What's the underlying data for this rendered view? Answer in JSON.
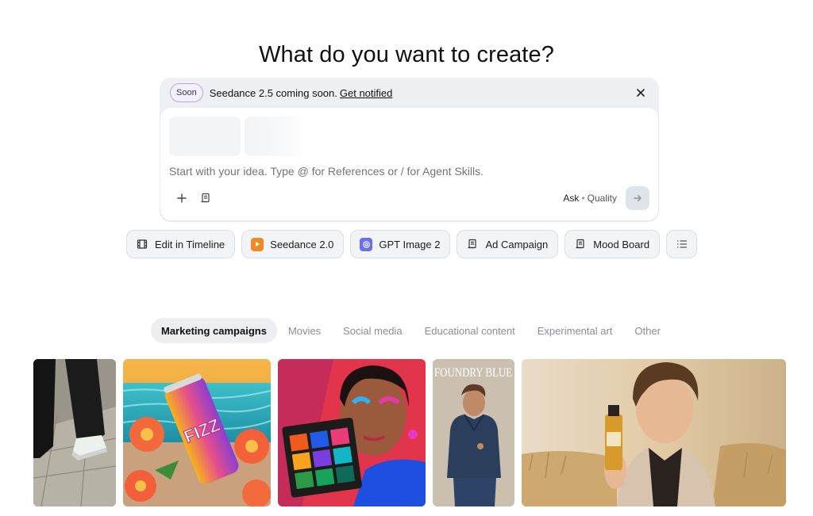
{
  "page": {
    "title": "What do you want to create?"
  },
  "banner": {
    "badge": "Soon",
    "text": "Seedance 2.5 coming soon.",
    "link": "Get notified",
    "close_icon": "close-icon"
  },
  "composer": {
    "placeholder": "Start with your idea. Type @ for References or / for Agent Skills.",
    "model": "Ask",
    "separator": "•",
    "quality": "Quality",
    "add_icon": "plus-icon",
    "skills_icon": "scroll-icon",
    "send_icon": "arrow-right-icon"
  },
  "chips": [
    {
      "label": "Edit in Timeline",
      "icon": "film-icon"
    },
    {
      "label": "Seedance 2.0",
      "icon": "seedance-icon"
    },
    {
      "label": "GPT Image 2",
      "icon": "gpt-icon"
    },
    {
      "label": "Ad Campaign",
      "icon": "scroll-icon"
    },
    {
      "label": "Mood Board",
      "icon": "scroll-icon"
    },
    {
      "label": "",
      "icon": "list-icon"
    }
  ],
  "tabs": [
    {
      "label": "Marketing campaigns",
      "active": true
    },
    {
      "label": "Movies",
      "active": false
    },
    {
      "label": "Social media",
      "active": false
    },
    {
      "label": "Educational content",
      "active": false
    },
    {
      "label": "Experimental art",
      "active": false
    },
    {
      "label": "Other",
      "active": false
    }
  ],
  "gallery": [
    {
      "subject": "sneaker-walking-photo"
    },
    {
      "subject": "fizz-can-poolside-photo",
      "text": "FIZZ"
    },
    {
      "subject": "makeup-palette-portrait-photo"
    },
    {
      "subject": "denim-magazine-cover-photo",
      "text": "FOUNDRY BLUE"
    },
    {
      "subject": "perfume-bottle-portrait-photo"
    }
  ],
  "colors": {
    "accent_purple": "#b9a6e0",
    "seedance_orange": "#f08a26",
    "gpt_indigo": "#6a6ef0"
  }
}
